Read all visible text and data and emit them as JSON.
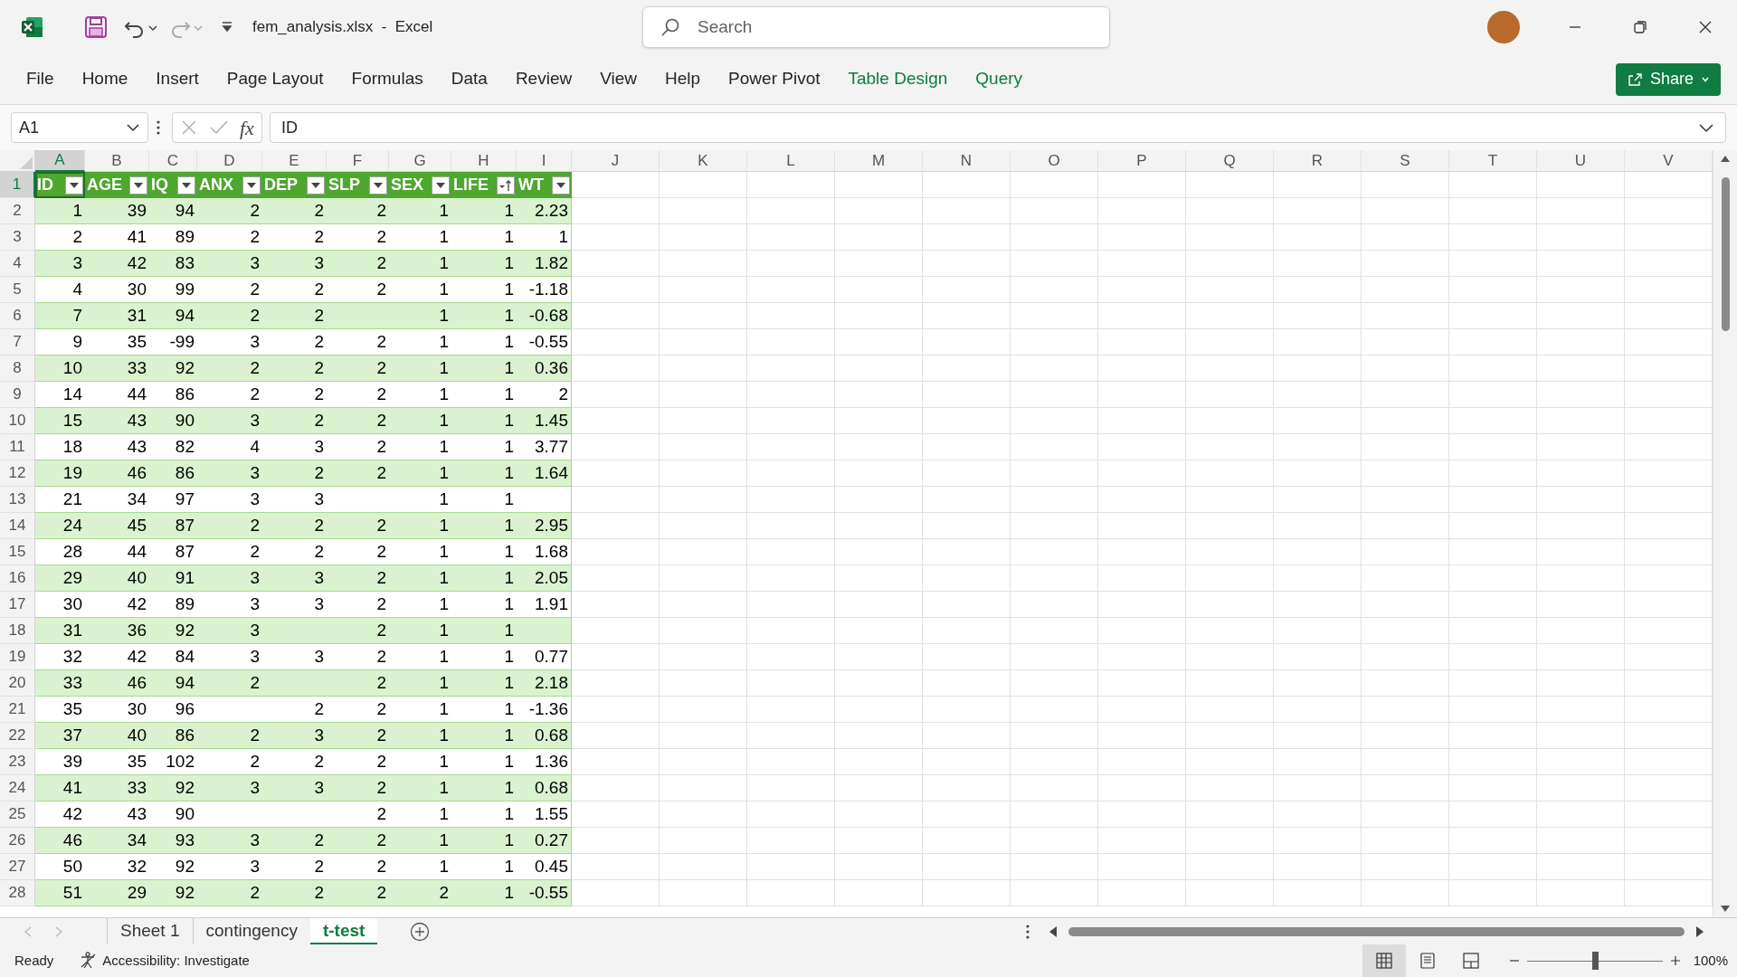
{
  "title_bar": {
    "title": "fem_analysis.xlsx  -  Excel",
    "search": {
      "placeholder": "Search"
    }
  },
  "ribbon_tabs": [
    {
      "label": "File",
      "kind": "standard"
    },
    {
      "label": "Home",
      "kind": "standard"
    },
    {
      "label": "Insert",
      "kind": "standard"
    },
    {
      "label": "Page Layout",
      "kind": "standard"
    },
    {
      "label": "Formulas",
      "kind": "standard"
    },
    {
      "label": "Data",
      "kind": "standard"
    },
    {
      "label": "Review",
      "kind": "standard"
    },
    {
      "label": "View",
      "kind": "standard"
    },
    {
      "label": "Help",
      "kind": "standard"
    },
    {
      "label": "Power Pivot",
      "kind": "standard"
    },
    {
      "label": "Table Design",
      "kind": "contextual"
    },
    {
      "label": "Query",
      "kind": "contextual"
    }
  ],
  "share_button": "Share",
  "formula_bar": {
    "name_box": "A1",
    "function_symbol": "fx",
    "formula": "ID"
  },
  "column_headers": [
    {
      "label": "A",
      "selected": true
    },
    {
      "label": "B",
      "selected": false
    },
    {
      "label": "C",
      "selected": false
    },
    {
      "label": "D",
      "selected": false
    },
    {
      "label": "E",
      "selected": false
    },
    {
      "label": "F",
      "selected": false
    },
    {
      "label": "G",
      "selected": false
    },
    {
      "label": "H",
      "selected": false
    },
    {
      "label": "I",
      "selected": false
    },
    {
      "label": "J",
      "selected": false
    },
    {
      "label": "K",
      "selected": false
    },
    {
      "label": "L",
      "selected": false
    },
    {
      "label": "M",
      "selected": false
    },
    {
      "label": "N",
      "selected": false
    },
    {
      "label": "O",
      "selected": false
    },
    {
      "label": "P",
      "selected": false
    },
    {
      "label": "Q",
      "selected": false
    },
    {
      "label": "R",
      "selected": false
    },
    {
      "label": "S",
      "selected": false
    },
    {
      "label": "T",
      "selected": false
    },
    {
      "label": "U",
      "selected": false
    },
    {
      "label": "V",
      "selected": false
    }
  ],
  "row_headers": [
    {
      "label": "1",
      "selected": true
    },
    {
      "label": "2",
      "selected": false
    },
    {
      "label": "3",
      "selected": false
    },
    {
      "label": "4",
      "selected": false
    },
    {
      "label": "5",
      "selected": false
    },
    {
      "label": "6",
      "selected": false
    },
    {
      "label": "7",
      "selected": false
    },
    {
      "label": "8",
      "selected": false
    },
    {
      "label": "9",
      "selected": false
    },
    {
      "label": "10",
      "selected": false
    },
    {
      "label": "11",
      "selected": false
    },
    {
      "label": "12",
      "selected": false
    },
    {
      "label": "13",
      "selected": false
    },
    {
      "label": "14",
      "selected": false
    },
    {
      "label": "15",
      "selected": false
    },
    {
      "label": "16",
      "selected": false
    },
    {
      "label": "17",
      "selected": false
    },
    {
      "label": "18",
      "selected": false
    },
    {
      "label": "19",
      "selected": false
    },
    {
      "label": "20",
      "selected": false
    },
    {
      "label": "21",
      "selected": false
    },
    {
      "label": "22",
      "selected": false
    },
    {
      "label": "23",
      "selected": false
    },
    {
      "label": "24",
      "selected": false
    },
    {
      "label": "25",
      "selected": false
    },
    {
      "label": "26",
      "selected": false
    },
    {
      "label": "27",
      "selected": false
    },
    {
      "label": "28",
      "selected": false
    }
  ],
  "table": {
    "columns": [
      {
        "label": "ID",
        "sorted_ascending": false
      },
      {
        "label": "AGE",
        "sorted_ascending": false
      },
      {
        "label": "IQ",
        "sorted_ascending": false
      },
      {
        "label": "ANX",
        "sorted_ascending": false
      },
      {
        "label": "DEP",
        "sorted_ascending": false
      },
      {
        "label": "SLP",
        "sorted_ascending": false
      },
      {
        "label": "SEX",
        "sorted_ascending": false
      },
      {
        "label": "LIFE",
        "sorted_ascending": true
      },
      {
        "label": "WT",
        "sorted_ascending": false
      }
    ],
    "rows": [
      [
        "1",
        "39",
        "94",
        "2",
        "2",
        "2",
        "1",
        "1",
        "2.23"
      ],
      [
        "2",
        "41",
        "89",
        "2",
        "2",
        "2",
        "1",
        "1",
        "1"
      ],
      [
        "3",
        "42",
        "83",
        "3",
        "3",
        "2",
        "1",
        "1",
        "1.82"
      ],
      [
        "4",
        "30",
        "99",
        "2",
        "2",
        "2",
        "1",
        "1",
        "-1.18"
      ],
      [
        "7",
        "31",
        "94",
        "2",
        "2",
        null,
        "1",
        "1",
        "-0.68"
      ],
      [
        "9",
        "35",
        "-99",
        "3",
        "2",
        "2",
        "1",
        "1",
        "-0.55"
      ],
      [
        "10",
        "33",
        "92",
        "2",
        "2",
        "2",
        "1",
        "1",
        "0.36"
      ],
      [
        "14",
        "44",
        "86",
        "2",
        "2",
        "2",
        "1",
        "1",
        "2"
      ],
      [
        "15",
        "43",
        "90",
        "3",
        "2",
        "2",
        "1",
        "1",
        "1.45"
      ],
      [
        "18",
        "43",
        "82",
        "4",
        "3",
        "2",
        "1",
        "1",
        "3.77"
      ],
      [
        "19",
        "46",
        "86",
        "3",
        "2",
        "2",
        "1",
        "1",
        "1.64"
      ],
      [
        "21",
        "34",
        "97",
        "3",
        "3",
        null,
        "1",
        "1",
        null
      ],
      [
        "24",
        "45",
        "87",
        "2",
        "2",
        "2",
        "1",
        "1",
        "2.95"
      ],
      [
        "28",
        "44",
        "87",
        "2",
        "2",
        "2",
        "1",
        "1",
        "1.68"
      ],
      [
        "29",
        "40",
        "91",
        "3",
        "3",
        "2",
        "1",
        "1",
        "2.05"
      ],
      [
        "30",
        "42",
        "89",
        "3",
        "3",
        "2",
        "1",
        "1",
        "1.91"
      ],
      [
        "31",
        "36",
        "92",
        "3",
        null,
        "2",
        "1",
        "1",
        null
      ],
      [
        "32",
        "42",
        "84",
        "3",
        "3",
        "2",
        "1",
        "1",
        "0.77"
      ],
      [
        "33",
        "46",
        "94",
        "2",
        null,
        "2",
        "1",
        "1",
        "2.18"
      ],
      [
        "35",
        "30",
        "96",
        null,
        "2",
        "2",
        "1",
        "1",
        "-1.36"
      ],
      [
        "37",
        "40",
        "86",
        "2",
        "3",
        "2",
        "1",
        "1",
        "0.68"
      ],
      [
        "39",
        "35",
        "102",
        "2",
        "2",
        "2",
        "1",
        "1",
        "1.36"
      ],
      [
        "41",
        "33",
        "92",
        "3",
        "3",
        "2",
        "1",
        "1",
        "0.68"
      ],
      [
        "42",
        "43",
        "90",
        null,
        null,
        "2",
        "1",
        "1",
        "1.55"
      ],
      [
        "46",
        "34",
        "93",
        "3",
        "2",
        "2",
        "1",
        "1",
        "0.27"
      ],
      [
        "50",
        "32",
        "92",
        "3",
        "2",
        "2",
        "1",
        "1",
        "0.45"
      ],
      [
        "51",
        "29",
        "92",
        "2",
        "2",
        "2",
        "2",
        "1",
        "-0.55"
      ]
    ]
  },
  "sheet_tabs": [
    {
      "label": "Sheet 1",
      "selected": false
    },
    {
      "label": "contingency",
      "selected": false
    },
    {
      "label": "t-test",
      "selected": true
    }
  ],
  "status_bar": {
    "status": "Ready",
    "accessibility": "Accessibility: Investigate",
    "views": [
      {
        "kind": "normal",
        "selected": true
      },
      {
        "kind": "page-layout",
        "selected": false
      },
      {
        "kind": "page-break",
        "selected": false
      }
    ],
    "zoom": {
      "level": 0.5,
      "reading": "100%"
    }
  }
}
